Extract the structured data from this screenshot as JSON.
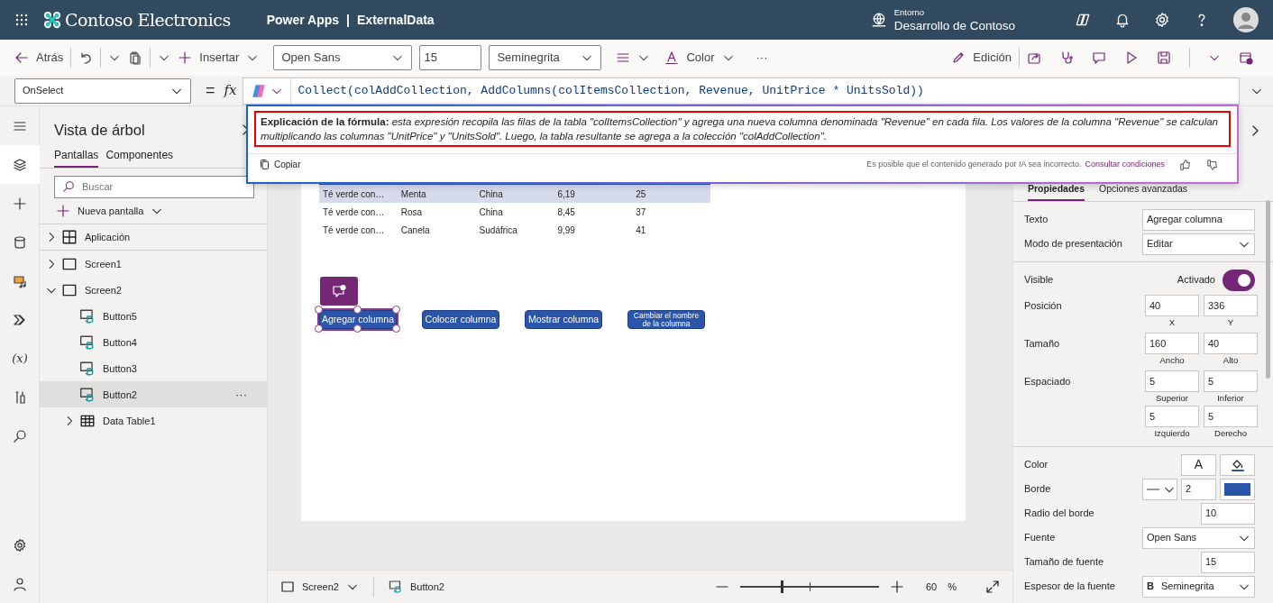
{
  "header": {
    "brand": "Contoso Electronics",
    "product": "Power Apps",
    "separator": "|",
    "document": "ExternalData",
    "environment_label": "Entorno",
    "environment": "Desarrollo de Contoso"
  },
  "toolbar": {
    "back": "Atrás",
    "insert": "Insertar",
    "font": "Open Sans",
    "size": "15",
    "weight": "Seminegrita",
    "color_label": "Color",
    "more": "···",
    "edit": "Edición"
  },
  "formula_bar": {
    "property": "OnSelect",
    "equals": "=",
    "fx": "fx",
    "formula": "Collect(colAddCollection, AddColumns(colItemsCollection, Revenue, UnitPrice * UnitsSold))"
  },
  "explanation": {
    "text": "**Explicación de la fórmula:** *esta expresión recopila las filas de la tabla \"colItemsCollection\" y agrega una nueva columna denominada \"Revenue\" en cada fila. Los valores de la columna \"Revenue\" se calculan multiplicando las columnas \"UnitPrice\" y \"UnitsSold\". Luego, la tabla resultante se agrega a la colección \"colAddCollection\".*",
    "copy": "Copiar",
    "disclaimer": "Es posible que el contenido generado por IA sea incorrecto.",
    "link": "Consultar condiciones"
  },
  "rail": [
    {
      "kind": "menu",
      "selected": false
    },
    {
      "kind": "layers",
      "selected": true
    },
    {
      "kind": "insert",
      "selected": false
    },
    {
      "kind": "data",
      "selected": false
    },
    {
      "kind": "media",
      "selected": false
    },
    {
      "kind": "automate",
      "selected": false
    },
    {
      "kind": "variables",
      "glyph": "(x)",
      "selected": false
    },
    {
      "kind": "tools",
      "selected": false
    },
    {
      "kind": "search",
      "selected": false
    },
    {
      "kind": "settings",
      "selected": false
    },
    {
      "kind": "account",
      "selected": false
    }
  ],
  "tree_panel": {
    "title": "Vista de árbol",
    "tabs": [
      {
        "label": "Pantallas",
        "selected": true
      },
      {
        "label": "Componentes",
        "selected": false
      }
    ],
    "search_placeholder": "Buscar",
    "new_screen": "Nueva pantalla",
    "items": [
      {
        "label": "Aplicación",
        "kind": "app",
        "expanded": false,
        "selected": false
      },
      {
        "label": "Screen1",
        "kind": "screen",
        "expanded": false,
        "selected": false
      },
      {
        "label": "Screen2",
        "kind": "screen",
        "expanded": true,
        "selected": false,
        "children": [
          {
            "label": "Button5",
            "kind": "button",
            "selected": false
          },
          {
            "label": "Button4",
            "kind": "button",
            "selected": false
          },
          {
            "label": "Button3",
            "kind": "button",
            "selected": false
          },
          {
            "label": "Button2",
            "kind": "button",
            "selected": true,
            "more": "···"
          },
          {
            "label": "Data Table1",
            "kind": "table",
            "expanded": false,
            "selected": false
          }
        ]
      }
    ]
  },
  "canvas": {
    "table": {
      "rows": [
        {
          "cells": [
            "Té verde con…",
            "Menta",
            "China",
            "6,19",
            "25"
          ],
          "selected": true
        },
        {
          "cells": [
            "Té verde con…",
            "Rosa",
            "China",
            "8,45",
            "37"
          ],
          "selected": false
        },
        {
          "cells": [
            "Té verde con…",
            "Canela",
            "Sudáfrica",
            "9,99",
            "41"
          ],
          "selected": false
        }
      ]
    },
    "buttons": [
      {
        "label": "Agregar columna",
        "selected": true
      },
      {
        "label": "Colocar columna",
        "selected": false
      },
      {
        "label": "Mostrar columna",
        "selected": false
      },
      {
        "label": "Cambiar el nombre de la columna",
        "selected": false
      }
    ]
  },
  "properties": {
    "tabs": [
      {
        "label": "Propiedades",
        "selected": true
      },
      {
        "label": "Opciones avanzadas",
        "selected": false
      }
    ],
    "sections": [
      [
        {
          "kind": "text",
          "label": "Texto",
          "value": "Agregar columna"
        },
        {
          "kind": "dropdown",
          "label": "Modo de presentación",
          "value": "Editar"
        }
      ],
      [
        {
          "kind": "toggle",
          "label": "Visible",
          "state_label": "Activado",
          "on": true
        },
        {
          "kind": "fields",
          "label": "Posición",
          "fields": [
            {
              "value": "40",
              "caption": "X"
            },
            {
              "value": "336",
              "caption": "Y"
            }
          ]
        },
        {
          "kind": "fields",
          "label": "Tamaño",
          "fields": [
            {
              "value": "160",
              "caption": "Ancho"
            },
            {
              "value": "40",
              "caption": "Alto"
            }
          ]
        },
        {
          "kind": "fields",
          "label": "Espaciado",
          "fields": [
            {
              "value": "5",
              "caption": "Superior"
            },
            {
              "value": "5",
              "caption": "Inferior"
            },
            {
              "value": "5",
              "caption": "Izquierdo"
            },
            {
              "value": "5",
              "caption": "Derecho"
            }
          ]
        }
      ],
      [
        {
          "kind": "color",
          "label": "Color",
          "glyph": "A"
        },
        {
          "kind": "border",
          "label": "Borde",
          "value": "2",
          "color": "#2b55a8"
        },
        {
          "kind": "number",
          "label": "Radio del borde",
          "value": "10"
        },
        {
          "kind": "dropdown",
          "label": "Fuente",
          "value": "Open Sans"
        },
        {
          "kind": "number",
          "label": "Tamaño de fuente",
          "value": "15"
        },
        {
          "kind": "dropdown",
          "label": "Espesor de la fuente",
          "prefix": "B",
          "value": "Seminegrita"
        }
      ]
    ]
  },
  "status_bar": {
    "screen": "Screen2",
    "control": "Button2",
    "zoom": {
      "level": 0.3
    },
    "zoom_value": "60",
    "zoom_unit": "%"
  }
}
